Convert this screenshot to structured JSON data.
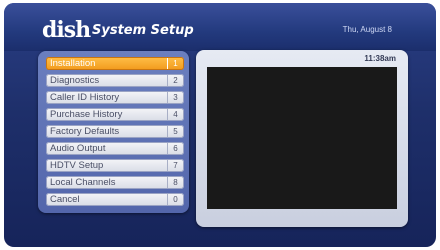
{
  "header": {
    "logo_text": "dish",
    "title": "System Setup",
    "date": "Thu, August 8"
  },
  "menu": {
    "items": [
      {
        "label": "Installation",
        "number": "1",
        "selected": true
      },
      {
        "label": "Diagnostics",
        "number": "2",
        "selected": false
      },
      {
        "label": "Caller ID History",
        "number": "3",
        "selected": false
      },
      {
        "label": "Purchase History",
        "number": "4",
        "selected": false
      },
      {
        "label": "Factory Defaults",
        "number": "5",
        "selected": false
      },
      {
        "label": "Audio Output",
        "number": "6",
        "selected": false
      },
      {
        "label": "HDTV Setup",
        "number": "7",
        "selected": false
      },
      {
        "label": "Local Channels",
        "number": "8",
        "selected": false
      },
      {
        "label": "Cancel",
        "number": "0",
        "selected": false
      }
    ]
  },
  "preview": {
    "time": "11:38am"
  },
  "colors": {
    "background": "#1e2f6a",
    "selected_item": "#f29a1c",
    "menu_panel": "#5e72b5"
  }
}
